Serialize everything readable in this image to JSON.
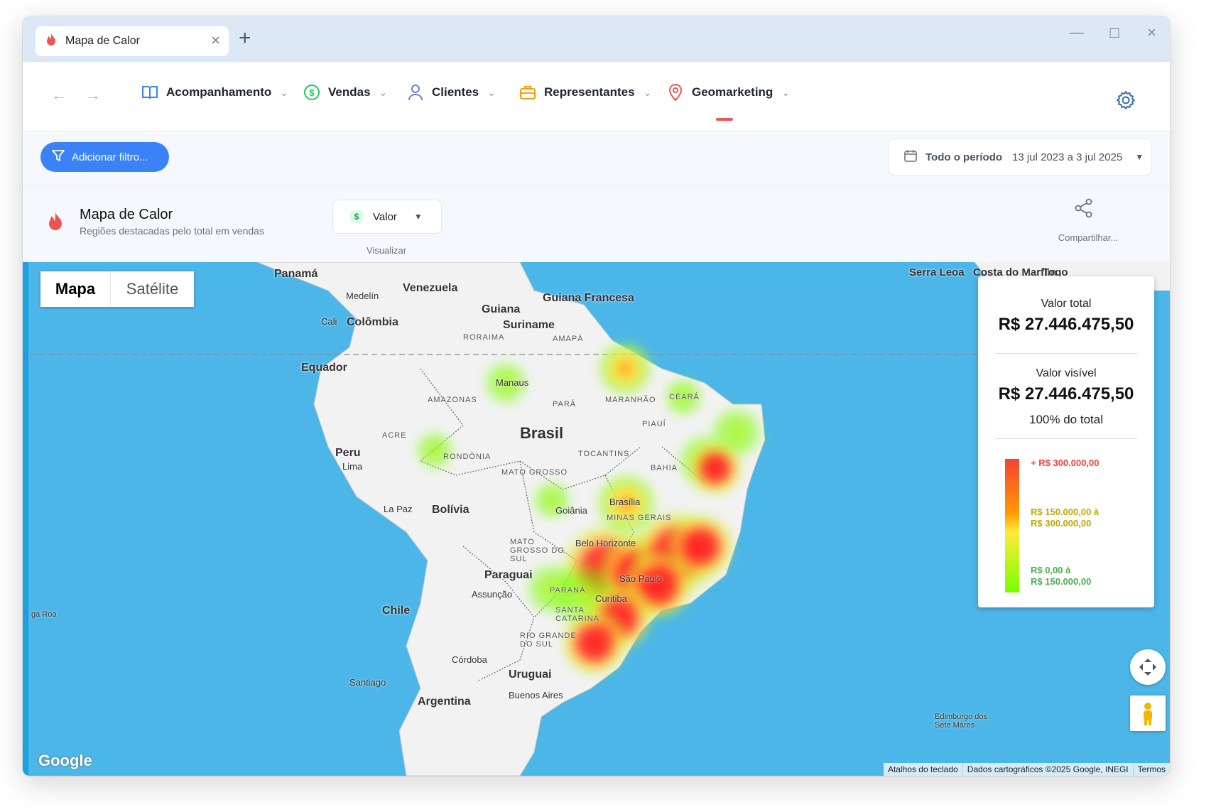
{
  "tab": {
    "title": "Mapa de Calor"
  },
  "nav": {
    "items": [
      {
        "label": "Acompanhamento"
      },
      {
        "label": "Vendas"
      },
      {
        "label": "Clientes"
      },
      {
        "label": "Representantes"
      },
      {
        "label": "Geomarketing"
      }
    ]
  },
  "filter": {
    "add_label": "Adicionar filtro..."
  },
  "period": {
    "label": "Todo o período",
    "value": "13 jul 2023 a 3 jul 2025"
  },
  "header": {
    "title": "Mapa de Calor",
    "subtitle": "Regiões destacadas pelo total em vendas",
    "select_value": "Valor",
    "select_caption": "Visualizar",
    "share_label": "Compartilhar..."
  },
  "map": {
    "toggle": {
      "map": "Mapa",
      "satellite": "Satélite"
    },
    "labels": {
      "panama": "Panamá",
      "venezuela": "Venezuela",
      "guiana": "Guiana",
      "guiana_fr": "Guiana Francesa",
      "suriname": "Suriname",
      "colombia": "Colômbia",
      "medelin": "Medelín",
      "cali": "Cali",
      "equador": "Equador",
      "peru": "Peru",
      "lima": "Lima",
      "brasil": "Brasil",
      "bolivia": "Bolívia",
      "lapaz": "La Paz",
      "paraguai": "Paraguai",
      "assuncao": "Assunção",
      "chile": "Chile",
      "santiago": "Santiago",
      "argentina": "Argentina",
      "cordoba": "Córdoba",
      "uruguai": "Uruguai",
      "buenos_aires": "Buenos Aires",
      "manaus": "Manaus",
      "brasilia": "Brasília",
      "goiania": "Goiânia",
      "belo_horizonte": "Belo Horizonte",
      "sao_paulo": "São Paulo",
      "curitiba": "Curitiba",
      "amazonas": "AMAZONAS",
      "para": "PARÁ",
      "acre": "ACRE",
      "rondonia": "RONDÔNIA",
      "mato_grosso": "MATO GROSSO",
      "tocantins": "TOCANTINS",
      "maranhao": "MARANHÃO",
      "piaui": "PIAUÍ",
      "ceara": "CEARÁ",
      "bahia": "BAHIA",
      "roraima": "RORAIMA",
      "amapa": "AMAPÁ",
      "minas": "MINAS GERAIS",
      "ms": "MATO GROSSO DO SUL",
      "parana": "PARANÁ",
      "sc": "SANTA CATARINA",
      "rs": "RIO GRANDE DO SUL",
      "serra_leoa": "Serra Leoa",
      "costa_marfim": "Costa do Marfim",
      "togo": "Togo",
      "edimburgo": "Edimburgo dos Sete Mares",
      "gaRoa": "ga Roa"
    },
    "footer": {
      "shortcuts": "Atalhos do teclado",
      "data": "Dados cartográficos ©2025 Google, INEGI",
      "terms": "Termos"
    },
    "google": "Google"
  },
  "legend": {
    "total_label": "Valor total",
    "total_value": "R$ 27.446.475,50",
    "visible_label": "Valor visível",
    "visible_value": "R$ 27.446.475,50",
    "visible_pct": "100% do total",
    "tier_high": "+ R$ 300.000,00",
    "tier_mid_a": "R$ 150.000,00 à",
    "tier_mid_b": "R$ 300.000,00",
    "tier_low_a": "R$ 0,00 à",
    "tier_low_b": "R$ 150.000,00",
    "colors": {
      "high": "#f44336",
      "mid": "#c0a800",
      "low": "#4caf50"
    }
  }
}
